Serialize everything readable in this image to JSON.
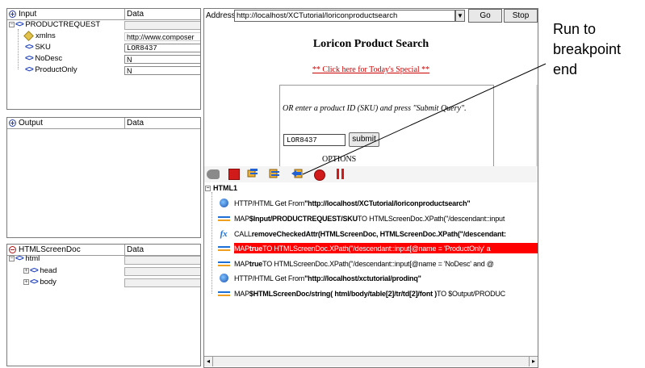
{
  "input_pane": {
    "header_name": "Input",
    "header_data": "Data",
    "rows": [
      {
        "label": "PRODUCTREQUEST",
        "value": ""
      },
      {
        "label": "xmlns",
        "value": "http://www.composer"
      },
      {
        "label": "SKU",
        "value": "LOR8437"
      },
      {
        "label": "NoDesc",
        "value": "N"
      },
      {
        "label": "ProductOnly",
        "value": "N"
      }
    ]
  },
  "output_pane": {
    "header_name": "Output",
    "header_data": "Data"
  },
  "htmlscreendoc_pane": {
    "header_name": "HTMLScreenDoc",
    "header_data": "Data",
    "rows": [
      {
        "label": "html"
      },
      {
        "label": "head"
      },
      {
        "label": "body"
      }
    ]
  },
  "browser": {
    "address_label": "Address:",
    "address_value": "http://localhost/XCTutorial/loriconproductsearch",
    "go_label": "Go",
    "stop_label": "Stop",
    "page_title": "Loricon Product Search",
    "special_link": "** Click here for Today's Special **",
    "prompt_text": "OR enter a product ID (SKU) and press \"Submit Query\".",
    "sku_value": "LOR8437",
    "submit_label": "submit",
    "options_label": "OPTIONS"
  },
  "steps": {
    "root_label": "HTML1",
    "items": [
      {
        "icon": "globe-icon",
        "prefix": "HTTP/HTML Get From ",
        "bold": "\"http://localhost/XCTutorial/loriconproductsearch\"",
        "suffix": "",
        "highlighted": false
      },
      {
        "icon": "map-arrows-icon",
        "prefix": "MAP ",
        "bold": "$Input/PRODUCTREQUEST/SKU",
        "suffix": " TO HTMLScreenDoc.XPath(\"/descendant::input",
        "highlighted": false
      },
      {
        "icon": "fx-icon",
        "prefix": "CALL ",
        "bold": "removeCheckedAttr(HTMLScreenDoc, HTMLScreenDoc.XPath(\"/descendant:",
        "suffix": "",
        "highlighted": false
      },
      {
        "icon": "map-arrows-icon",
        "prefix": "MAP ",
        "bold": "true",
        "suffix": " TO HTMLScreenDoc.XPath(\"/descendant::input[@name = 'ProductOnly' a",
        "highlighted": true
      },
      {
        "icon": "map-arrows-icon",
        "prefix": "MAP ",
        "bold": "true",
        "suffix": " TO HTMLScreenDoc.XPath(\"/descendant::input[@name = 'NoDesc' and @",
        "highlighted": false
      },
      {
        "icon": "globe-icon",
        "prefix": "HTTP/HTML Get From ",
        "bold": "\"http://localhost/xctutorial/prodinq\"",
        "suffix": "",
        "highlighted": false
      },
      {
        "icon": "map-arrows-icon",
        "prefix": "MAP ",
        "bold": "$HTMLScreenDoc/string( html/body/table[2]/tr/td[2]/font )",
        "suffix": " TO $Output/PRODUC",
        "highlighted": false
      }
    ]
  },
  "callout": {
    "line1": "Run to",
    "line2": "breakpoint",
    "line3": "end"
  },
  "colors": {
    "highlight": "#ff0000",
    "tag_blue": "#1d3fbf",
    "breakpoint_red": "#d11a1a",
    "link_red": "#cc0000"
  }
}
